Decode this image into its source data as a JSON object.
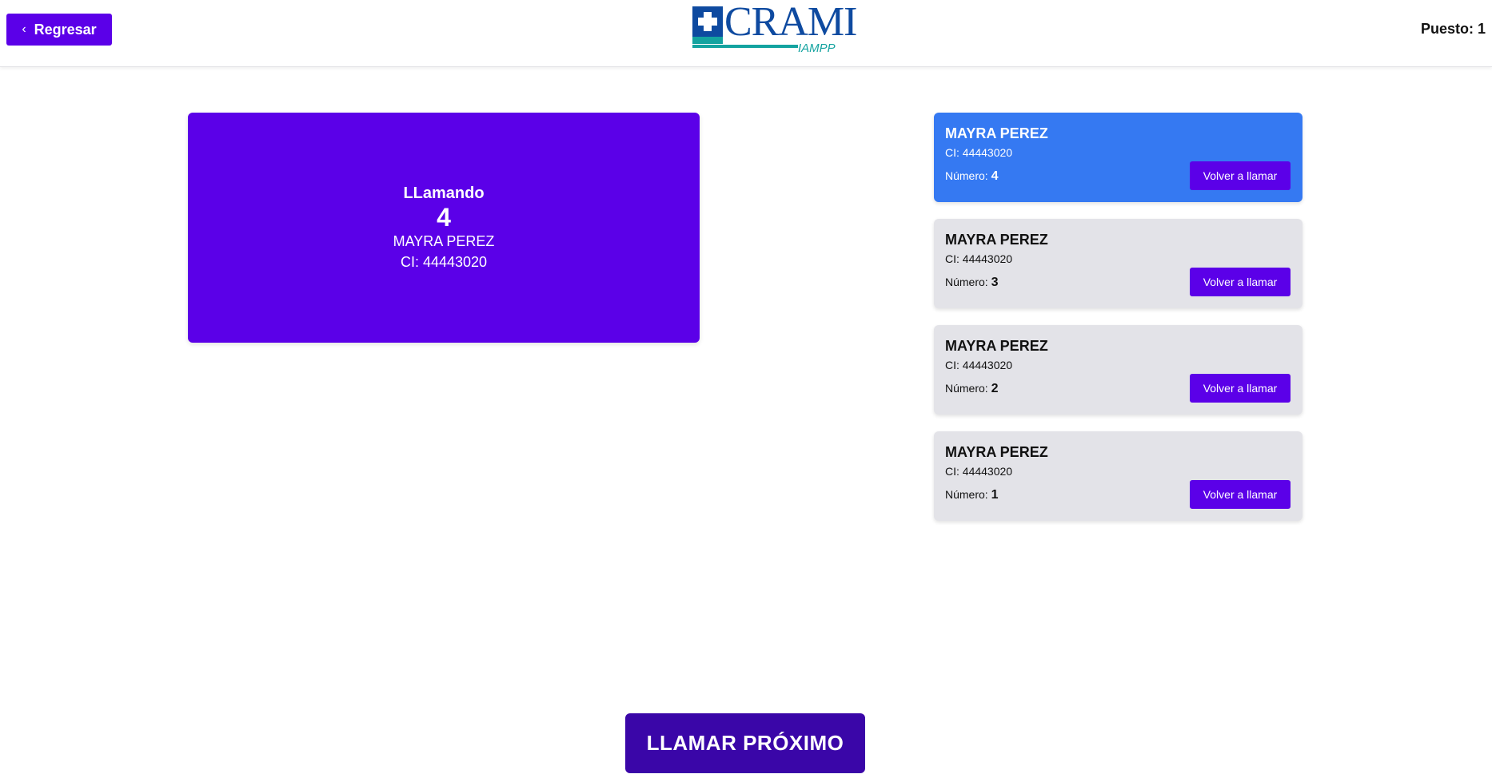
{
  "header": {
    "back_label": "Regresar",
    "logo_brand": "CRAMI",
    "logo_sub": "IAMPP",
    "puesto": "Puesto: 1"
  },
  "calling": {
    "title": "LLamando",
    "number": "4",
    "name": "MAYRA PEREZ",
    "ci": "CI: 44443020"
  },
  "queue": [
    {
      "name": "MAYRA PEREZ",
      "ci": "CI: 44443020",
      "numero_label": "Número:",
      "numero": "4",
      "button": "Volver a llamar",
      "active": true
    },
    {
      "name": "MAYRA PEREZ",
      "ci": "CI: 44443020",
      "numero_label": "Número:",
      "numero": "3",
      "button": "Volver a llamar",
      "active": false
    },
    {
      "name": "MAYRA PEREZ",
      "ci": "CI: 44443020",
      "numero_label": "Número:",
      "numero": "2",
      "button": "Volver a llamar",
      "active": false
    },
    {
      "name": "MAYRA PEREZ",
      "ci": "CI: 44443020",
      "numero_label": "Número:",
      "numero": "1",
      "button": "Volver a llamar",
      "active": false
    }
  ],
  "call_next_label": "LLAMAR PRÓXIMO",
  "colors": {
    "primary": "#5b00e8",
    "active_card": "#3579f2",
    "card_bg": "#e3e3e8",
    "call_next": "#3a06a8",
    "logo_blue": "#0e4aa0",
    "logo_teal": "#14a3a0"
  },
  "icons": {
    "back": "chevron-left-icon",
    "logo_mark": "medical-cross-icon"
  }
}
